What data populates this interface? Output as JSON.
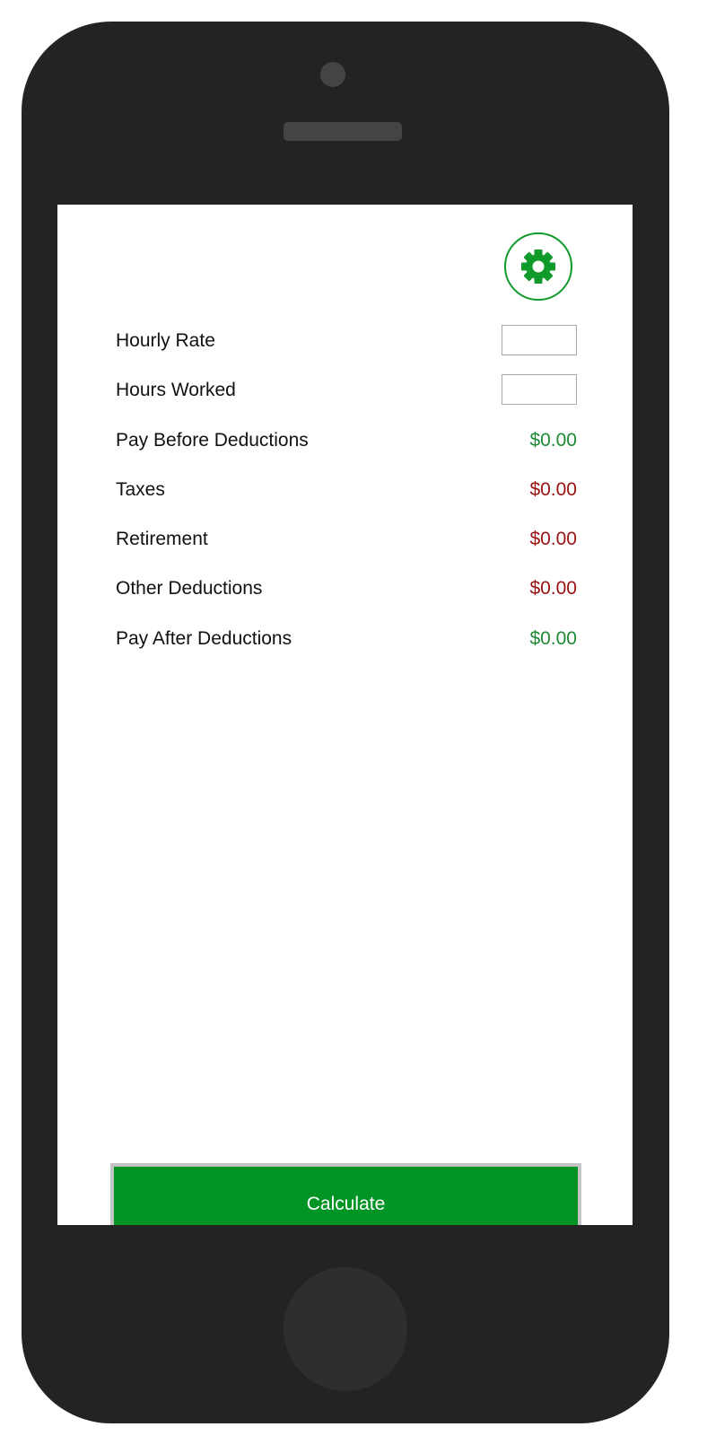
{
  "theme": {
    "accent": "#009424",
    "positive_color": "#1f8a35",
    "negative_color": "#9a1111",
    "device_frame": "#232323"
  },
  "header": {
    "settings_icon": "gear-icon"
  },
  "rows": [
    {
      "label": "Hourly Rate",
      "kind": "input",
      "value": ""
    },
    {
      "label": "Hours Worked",
      "kind": "input",
      "value": ""
    },
    {
      "label": "Pay Before Deductions",
      "kind": "output",
      "value": "$0.00",
      "status": "positive"
    },
    {
      "label": "Taxes",
      "kind": "output",
      "value": "$0.00",
      "status": "negative"
    },
    {
      "label": "Retirement",
      "kind": "output",
      "value": "$0.00",
      "status": "negative"
    },
    {
      "label": "Other Deductions",
      "kind": "output",
      "value": "$0.00",
      "status": "negative"
    },
    {
      "label": "Pay After Deductions",
      "kind": "output",
      "value": "$0.00",
      "status": "positive"
    }
  ],
  "actions": {
    "calculate_label": "Calculate"
  }
}
